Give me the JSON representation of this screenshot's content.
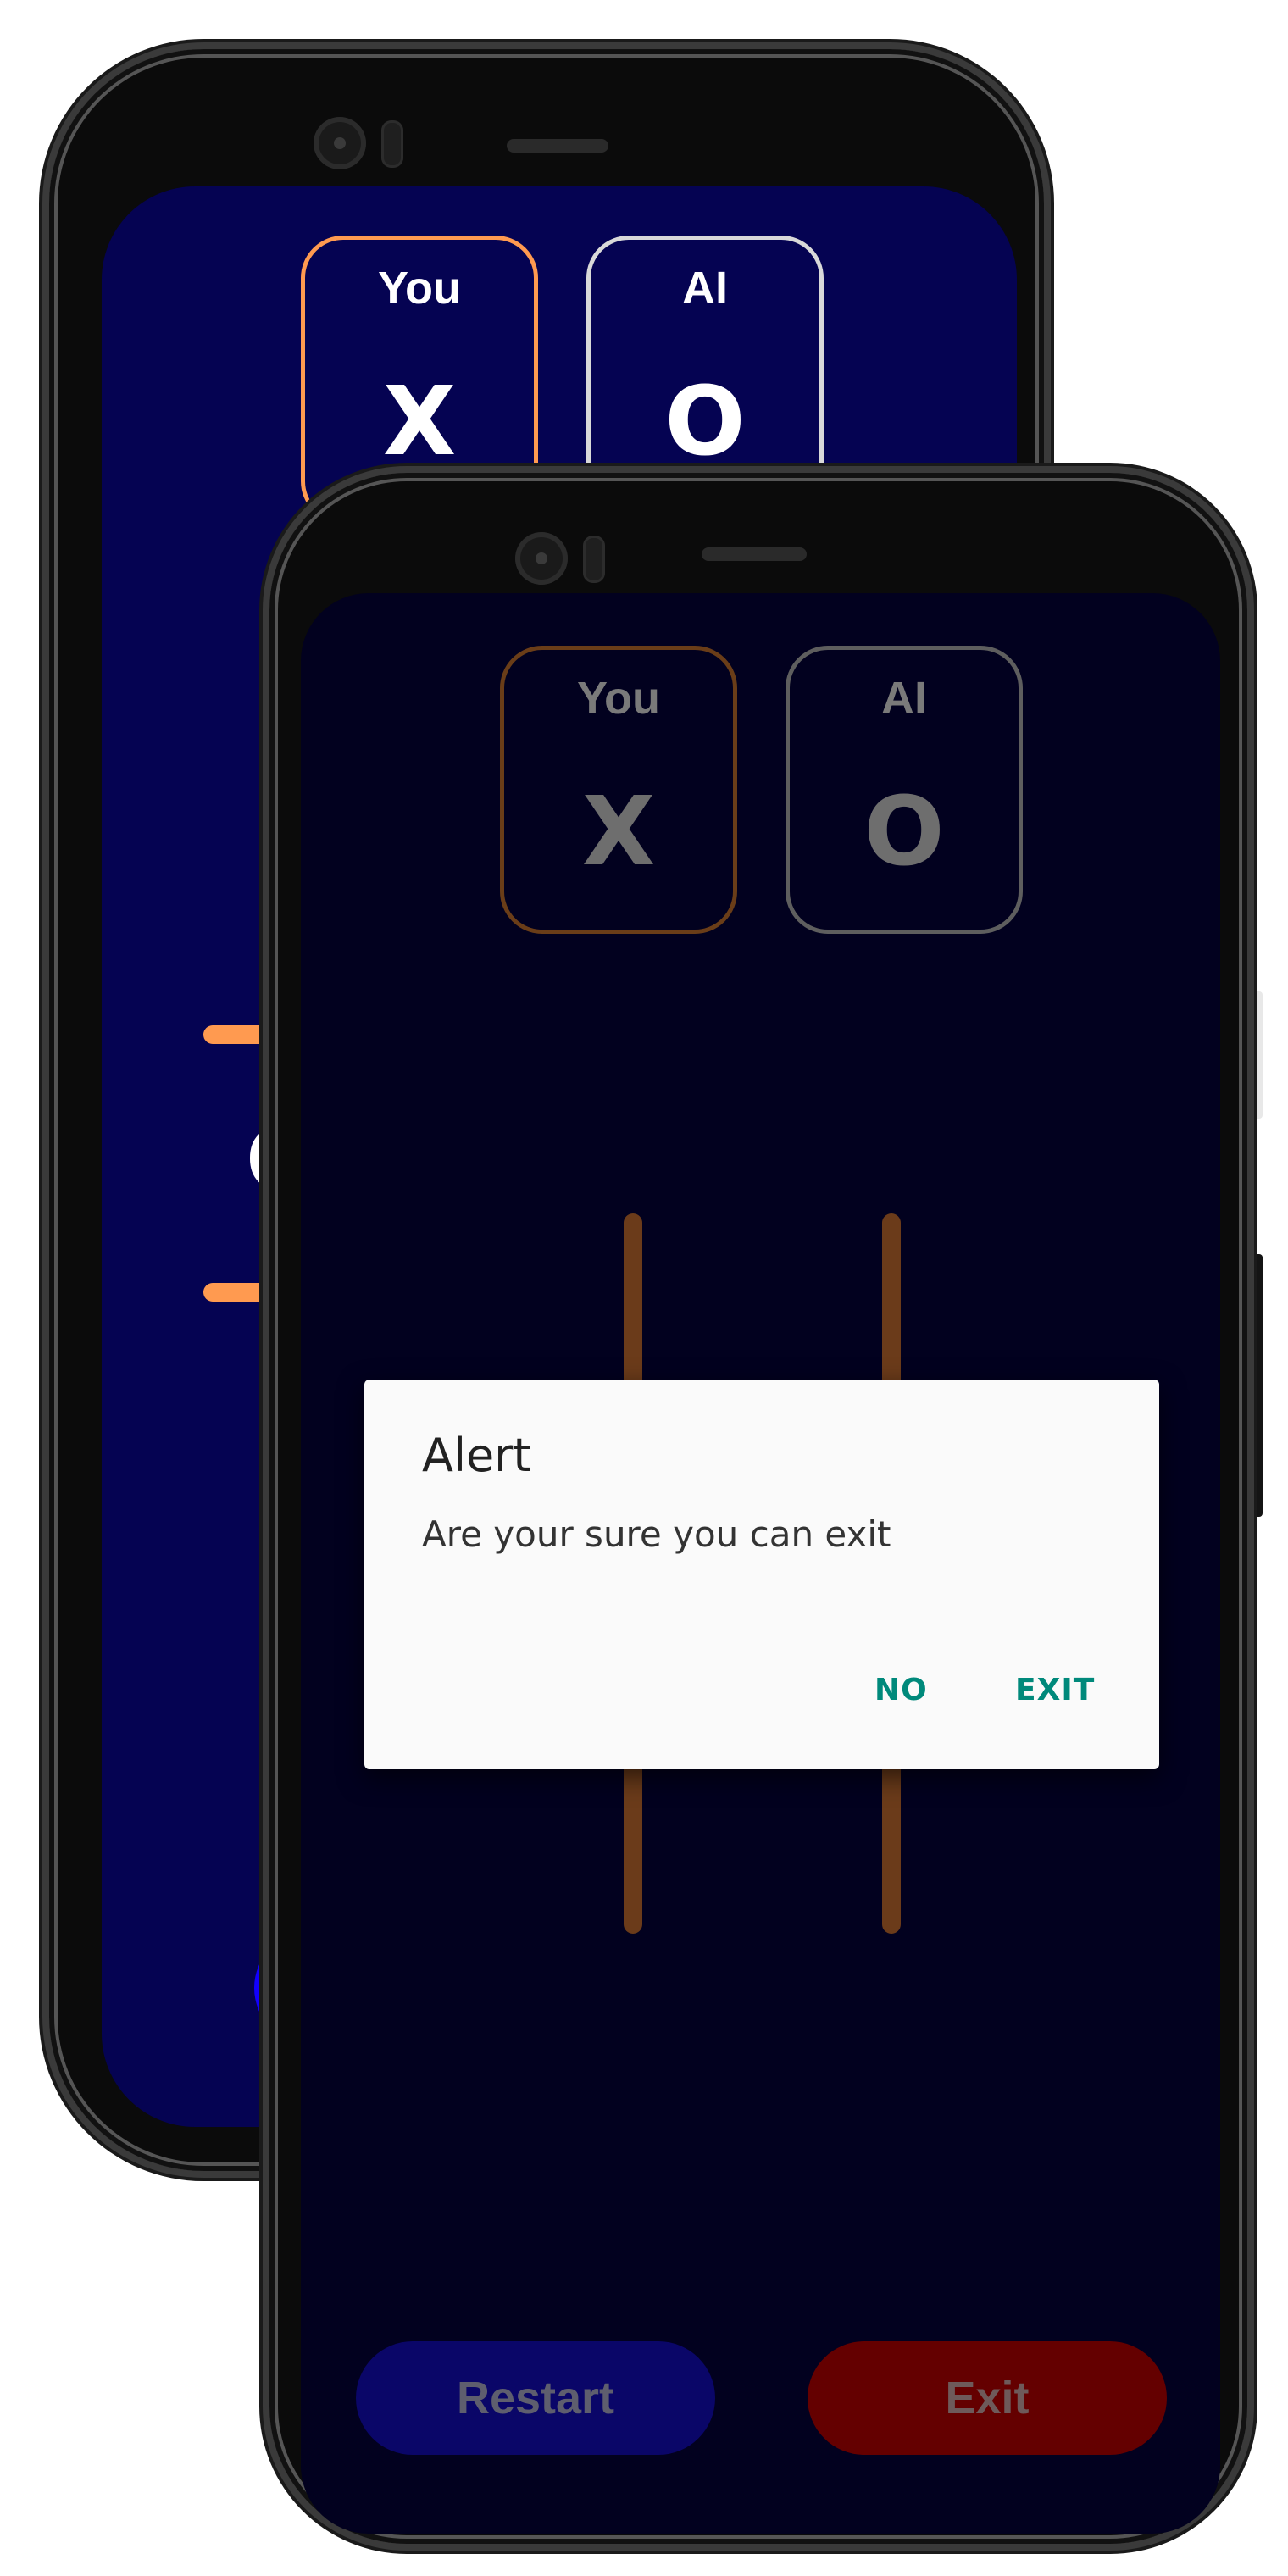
{
  "back_phone": {
    "players": [
      {
        "label": "You",
        "symbol": "X"
      },
      {
        "label": "AI",
        "symbol": "O"
      }
    ],
    "colors": {
      "screen": "#050352",
      "accent": "#ff9a50",
      "button": "#1200ff"
    }
  },
  "front_phone": {
    "players": [
      {
        "label": "You",
        "symbol": "X"
      },
      {
        "label": "AI",
        "symbol": "O"
      }
    ],
    "buttons": {
      "restart": "Restart",
      "exit": "Exit"
    },
    "colors": {
      "screen": "#02011f",
      "grid_line": "#6b3b1a",
      "restart": "#0a0668",
      "exit": "#640000"
    }
  },
  "dialog": {
    "title": "Alert",
    "message": "Are your sure you can exit",
    "no_label": "NO",
    "exit_label": "EXIT",
    "button_color": "#00897b"
  }
}
